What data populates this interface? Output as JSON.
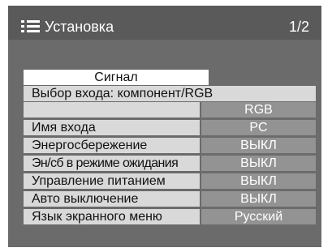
{
  "header": {
    "title": "Установка",
    "page_indicator": "1/2",
    "icon": "menu-list-icon"
  },
  "signal_button": {
    "label": "Сигнал"
  },
  "input_select": {
    "label": "Выбор входа: компонент/RGB",
    "value": "RGB"
  },
  "items": [
    {
      "label": "Имя входа",
      "value": "PC"
    },
    {
      "label": "Энергосбережение",
      "value": "ВЫКЛ"
    },
    {
      "label": "Эн/сб в режиме ожидания",
      "value": "ВЫКЛ"
    },
    {
      "label": "Управление питанием",
      "value": "ВЫКЛ"
    },
    {
      "label": "Авто выключение",
      "value": "ВЫКЛ"
    },
    {
      "label": "Язык экранного меню",
      "value": "Русский"
    }
  ],
  "colors": {
    "panel": "#6b6b6b",
    "titlebar": "#5a5a5a",
    "label_bg": "#d9d9d9",
    "value_bg": "#939393",
    "highlight": "#ffffff"
  }
}
